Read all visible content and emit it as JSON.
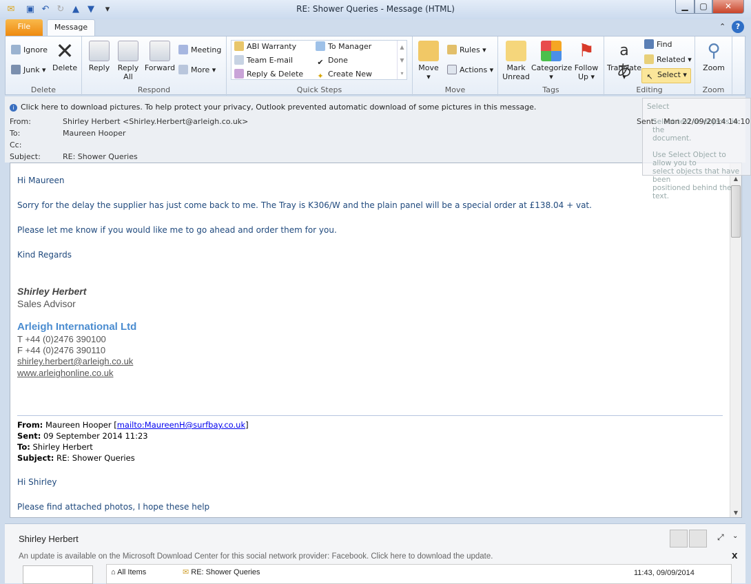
{
  "window": {
    "title": "RE: Shower Queries  -  Message (HTML)",
    "minimize": "▁",
    "maximize": "▢",
    "close": "✕"
  },
  "qat": {
    "icons": [
      "mail-icon",
      "save-icon",
      "undo-icon",
      "redo-icon",
      "up-icon",
      "down-icon",
      "customize-icon"
    ]
  },
  "tabs": {
    "file": "File",
    "message": "Message"
  },
  "ribbon": {
    "delete": {
      "label": "Delete",
      "ignore": "Ignore",
      "junk": "Junk",
      "delete": "Delete"
    },
    "respond": {
      "label": "Respond",
      "reply": "Reply",
      "reply_all_1": "Reply",
      "reply_all_2": "All",
      "forward": "Forward",
      "meeting": "Meeting",
      "more": "More"
    },
    "quick_steps": {
      "label": "Quick Steps",
      "items": [
        "ABI Warranty",
        "To Manager",
        "Team E-mail",
        "Done",
        "Reply & Delete",
        "Create New"
      ]
    },
    "move": {
      "label": "Move",
      "move": "Move",
      "rules": "Rules",
      "actions": "Actions"
    },
    "tags": {
      "label": "Tags",
      "mark_1": "Mark",
      "mark_2": "Unread",
      "categorize": "Categorize",
      "follow_1": "Follow",
      "follow_2": "Up"
    },
    "editing": {
      "label": "Editing",
      "translate": "Translate",
      "find": "Find",
      "related": "Related",
      "select": "Select"
    },
    "zoom": {
      "label": "Zoom",
      "zoom": "Zoom"
    }
  },
  "infobar": "Click here to download pictures. To help protect your privacy, Outlook prevented automatic download of some pictures in this message.",
  "header": {
    "from_label": "From:",
    "from": "Shirley Herbert <Shirley.Herbert@arleigh.co.uk>",
    "to_label": "To:",
    "to": "Maureen Hooper",
    "cc_label": "Cc:",
    "cc": "",
    "subject_label": "Subject:",
    "subject": "RE: Shower Queries",
    "sent_label": "Sent:",
    "sent": "Mon 22/09/2014 14:10"
  },
  "tooltip": {
    "title": "Select",
    "line1": "Select text or objects in the",
    "line2": "document.",
    "line3": "Use Select Object to allow you to",
    "line4": "select objects that have been",
    "line5": "positioned behind the text."
  },
  "message": {
    "greeting": "Hi Maureen",
    "p1": "Sorry for the delay the supplier has just come back to me.  The Tray is K306/W and the plain panel will be a special order at £138.04 + vat.",
    "p2": "Please let me know if you would like me to go ahead and order them for you.",
    "closing": "Kind Regards",
    "sig_name": "Shirley Herbert",
    "sig_title": "Sales Advisor",
    "sig_company": "Arleigh International Ltd",
    "sig_tel": "T +44 (0)2476 390100",
    "sig_fax": "F +44 (0)2476 390110",
    "sig_email": "shirley.herbert@arleigh.co.uk",
    "sig_web": "www.arleighonline.co.uk",
    "quoted": {
      "from_label": "From:",
      "from": "Maureen Hooper [",
      "from_link": "mailto:MaureenH@surfbay.co.uk",
      "from_end": "]",
      "sent_label": "Sent:",
      "sent": "09 September 2014 11:23",
      "to_label": "To:",
      "to": "Shirley Herbert",
      "subject_label": "Subject:",
      "subject": "RE: Shower Queries",
      "greeting": "Hi Shirley",
      "p1": "Please find attached photos, I hope these help"
    }
  },
  "people_pane": {
    "name": "Shirley Herbert",
    "update": "An update is available on the Microsoft Download Center for this social network provider: Facebook. Click here to download the update.",
    "close": "X",
    "all_items": "All Items",
    "item_subject": "RE: Shower Queries",
    "item_date": "11:43, 09/09/2014"
  },
  "colors": {
    "file_tab": "#f39a1e",
    "body_text": "#1f497d",
    "company": "#4a8cd0",
    "select_highlight": "#fbe69a"
  }
}
